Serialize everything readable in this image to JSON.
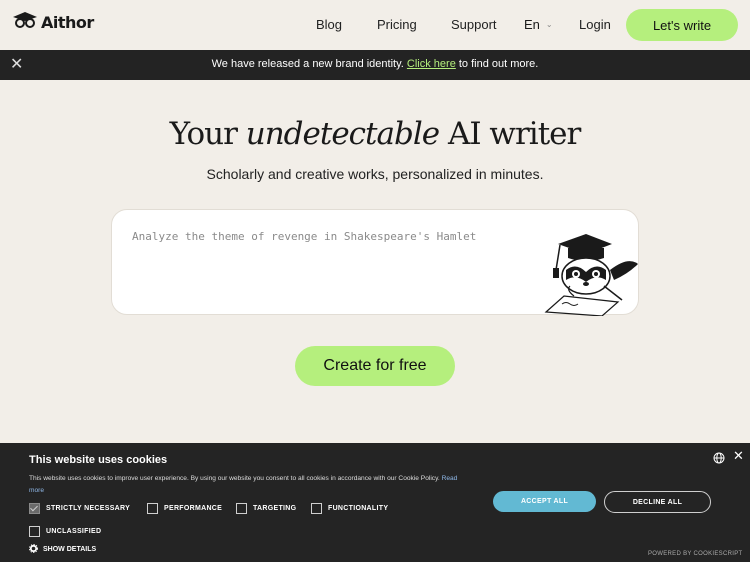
{
  "nav": {
    "logo_text": "Aithor",
    "links": [
      "Blog",
      "Pricing",
      "Support"
    ],
    "language": "En",
    "login": "Login",
    "cta": "Let's write"
  },
  "banner": {
    "text_before": "We have released a new brand identity. ",
    "link": "Click here",
    "text_after": " to find out more."
  },
  "hero": {
    "title_start": "Your ",
    "title_italic": "undetectable",
    "title_end": " AI writer",
    "subtitle": "Scholarly and creative works, personalized in minutes.",
    "prompt_placeholder": "Analyze the theme of revenge in Shakespeare's Hamlet",
    "create_button": "Create for free"
  },
  "cookie": {
    "title": "This website uses cookies",
    "text": "This website uses cookies to improve user experience. By using our website you consent to all cookies in accordance with our Cookie Policy.",
    "read_more": "Read more",
    "options": {
      "strictly_necessary": "STRICTLY NECESSARY",
      "performance": "PERFORMANCE",
      "targeting": "TARGETING",
      "functionality": "FUNCTIONALITY",
      "unclassified": "UNCLASSIFIED"
    },
    "strictly_necessary_checked": true,
    "show_details": "SHOW DETAILS",
    "accept": "ACCEPT ALL",
    "decline": "DECLINE ALL",
    "powered": "POWERED BY COOKIESCRIPT"
  },
  "colors": {
    "background": "#f2eee8",
    "accent_green": "#b5ef7d",
    "banner_bg": "#232323",
    "cookie_bg": "#242424",
    "accept_blue": "#62b9d3"
  }
}
